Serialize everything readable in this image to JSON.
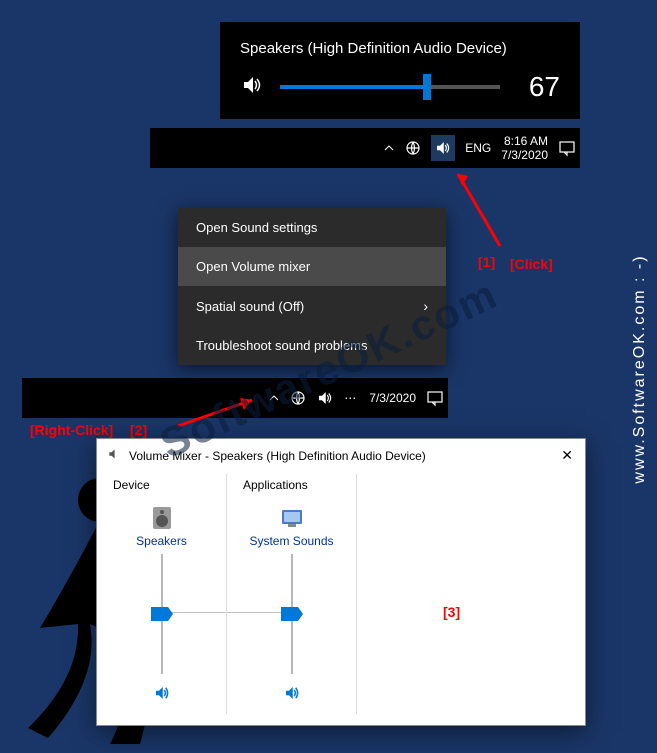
{
  "volumeFlyout": {
    "deviceName": "Speakers (High Definition Audio Device)",
    "level": "67"
  },
  "taskbar1": {
    "lang": "ENG",
    "time": "8:16 AM",
    "date": "7/3/2020"
  },
  "taskbar2": {
    "date": "7/3/2020"
  },
  "contextMenu": {
    "items": [
      "Open Sound settings",
      "Open Volume mixer",
      "Spatial sound (Off)",
      "Troubleshoot sound problems"
    ]
  },
  "mixer": {
    "title": "Volume Mixer - Speakers (High Definition Audio Device)",
    "sections": {
      "device": "Device",
      "applications": "Applications"
    },
    "devices": [
      {
        "name": "Speakers"
      },
      {
        "name": "System Sounds"
      }
    ]
  },
  "annotations": {
    "a1": "[1]",
    "a1label": "[Click]",
    "a2": "[2]",
    "a2label": "[Right-Click]",
    "a3": "[3]"
  },
  "watermark": {
    "side": "www.SoftwareOK.com : -)",
    "center": "SoftwareOK.com"
  }
}
